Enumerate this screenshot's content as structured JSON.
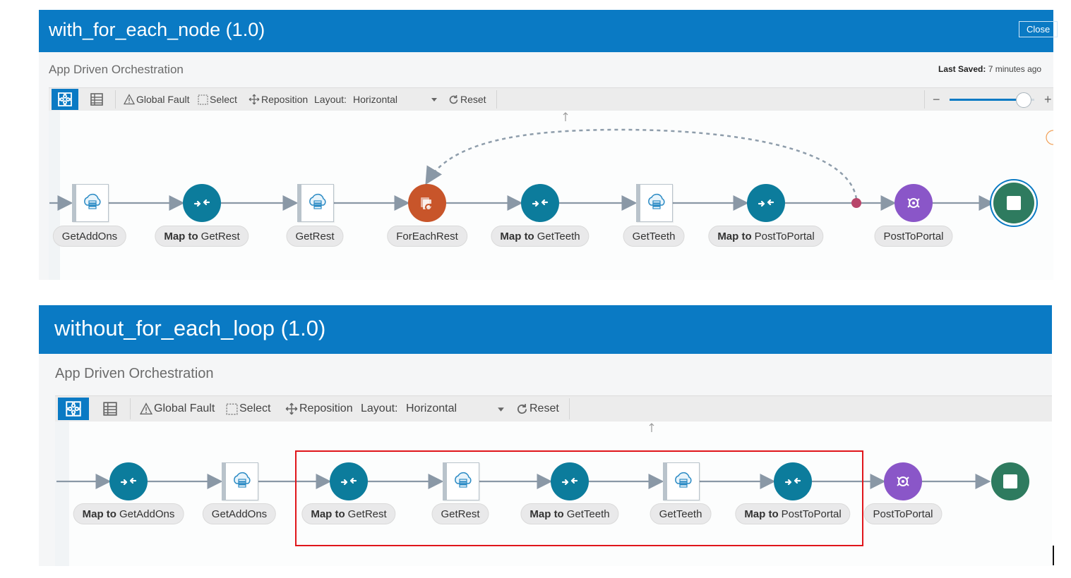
{
  "panels": [
    {
      "title": "with_for_each_node (1.0)",
      "close_label": "Close",
      "subtitle": "App Driven Orchestration",
      "last_saved_label": "Last Saved:",
      "last_saved_value": "7 minutes ago",
      "toolbar": {
        "global_fault": "Global Fault",
        "select": "Select",
        "reposition": "Reposition",
        "layout_label": "Layout:",
        "layout_value": "Horizontal",
        "reset": "Reset"
      },
      "zoom_level": 0.87,
      "nodes": [
        {
          "kind": "invoke",
          "label": "GetAddOns"
        },
        {
          "kind": "map",
          "bold": "Map to",
          "label": "GetRest"
        },
        {
          "kind": "invoke",
          "label": "GetRest"
        },
        {
          "kind": "foreach",
          "label": "ForEachRest"
        },
        {
          "kind": "map",
          "bold": "Map to",
          "label": "GetTeeth"
        },
        {
          "kind": "invoke",
          "label": "GetTeeth"
        },
        {
          "kind": "map",
          "bold": "Map to",
          "label": "PostToPortal"
        },
        {
          "kind": "integration",
          "label": "PostToPortal"
        },
        {
          "kind": "end",
          "label": ""
        }
      ]
    },
    {
      "title": "without_for_each_loop (1.0)",
      "subtitle": "App Driven Orchestration",
      "toolbar": {
        "global_fault": "Global Fault",
        "select": "Select",
        "reposition": "Reposition",
        "layout_label": "Layout:",
        "layout_value": "Horizontal",
        "reset": "Reset"
      },
      "nodes": [
        {
          "kind": "map",
          "bold": "Map to",
          "label": "GetAddOns"
        },
        {
          "kind": "invoke",
          "label": "GetAddOns"
        },
        {
          "kind": "map",
          "bold": "Map to",
          "label": "GetRest"
        },
        {
          "kind": "invoke",
          "label": "GetRest"
        },
        {
          "kind": "map",
          "bold": "Map to",
          "label": "GetTeeth"
        },
        {
          "kind": "invoke",
          "label": "GetTeeth"
        },
        {
          "kind": "map",
          "bold": "Map to",
          "label": "PostToPortal"
        },
        {
          "kind": "integration",
          "label": "PostToPortal"
        },
        {
          "kind": "end",
          "label": ""
        }
      ]
    }
  ],
  "colors": {
    "header": "#0a7ac4",
    "map_node": "#0c7c9c",
    "foreach_node": "#c8552a",
    "integration_node": "#8a56c8",
    "end_node": "#2e7b5f",
    "highlight": "#e0161b"
  }
}
